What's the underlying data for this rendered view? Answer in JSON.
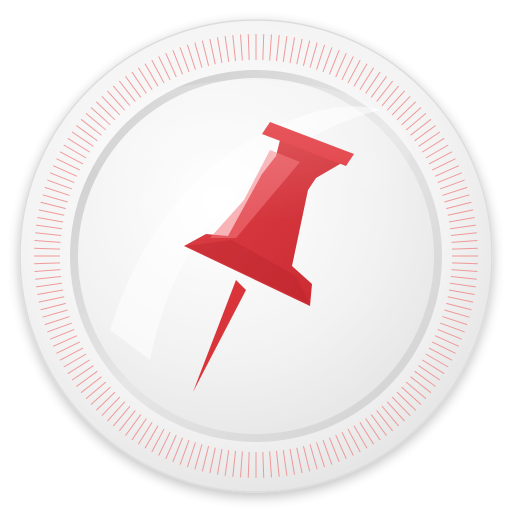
{
  "icon": {
    "name": "pushpin-icon",
    "colors": {
      "background": "#ffffff",
      "bezel": "#f2f2f2",
      "bezel_edge": "#dedede",
      "tick_marks": "#f08a8a",
      "face": "#f4f4f4",
      "face_ring": "#d6d6d6",
      "pin": "#d9343a",
      "pin_highlight": "#f06a6f"
    }
  }
}
